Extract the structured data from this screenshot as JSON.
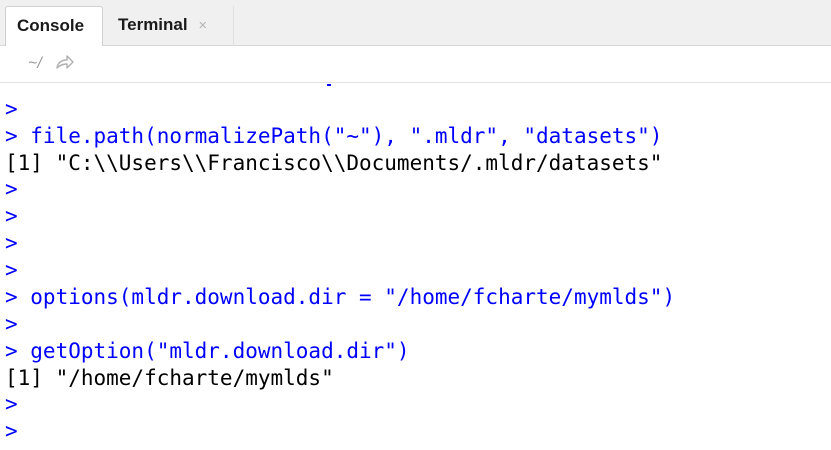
{
  "tabs": {
    "console_label": "Console",
    "terminal_label": "Terminal",
    "close_glyph": "×"
  },
  "pathbar": {
    "path": "~/"
  },
  "console": {
    "lines": [
      {
        "kind": "in",
        "text": ">"
      },
      {
        "kind": "in",
        "text": "> file.path(normalizePath(\"~\"), \".mldr\", \"datasets\")"
      },
      {
        "kind": "out",
        "text": "[1] \"C:\\\\Users\\\\Francisco\\\\Documents/.mldr/datasets\""
      },
      {
        "kind": "in",
        "text": ">"
      },
      {
        "kind": "in",
        "text": ">"
      },
      {
        "kind": "in",
        "text": ">"
      },
      {
        "kind": "in",
        "text": ">"
      },
      {
        "kind": "in",
        "text": "> options(mldr.download.dir = \"/home/fcharte/mymlds\")"
      },
      {
        "kind": "in",
        "text": ">"
      },
      {
        "kind": "in",
        "text": "> getOption(\"mldr.download.dir\")"
      },
      {
        "kind": "out",
        "text": "[1] \"/home/fcharte/mymlds\""
      },
      {
        "kind": "in",
        "text": ">"
      },
      {
        "kind": "in",
        "text": ">"
      }
    ]
  },
  "colors": {
    "input": "#0000ff",
    "output": "#000000"
  }
}
